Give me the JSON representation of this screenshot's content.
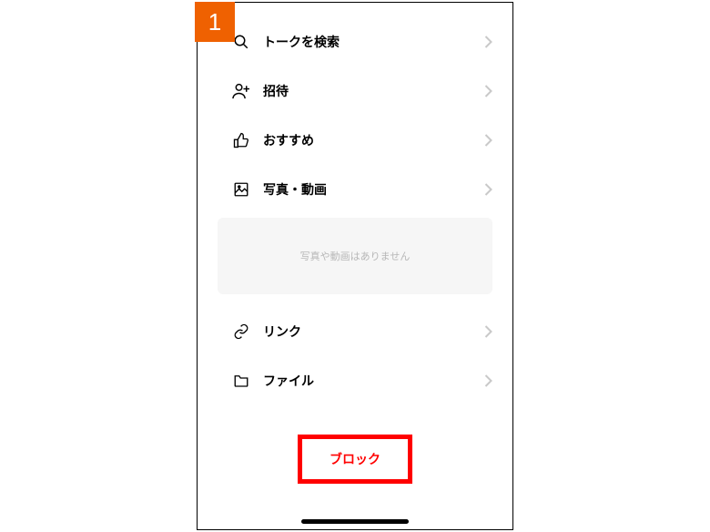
{
  "step_badge": "1",
  "menu": {
    "search": {
      "label": "トークを検索"
    },
    "invite": {
      "label": "招待"
    },
    "recommend": {
      "label": "おすすめ"
    },
    "media": {
      "label": "写真・動画",
      "empty_text": "写真や動画はありません"
    },
    "link": {
      "label": "リンク"
    },
    "file": {
      "label": "ファイル"
    }
  },
  "block_button_label": "ブロック"
}
